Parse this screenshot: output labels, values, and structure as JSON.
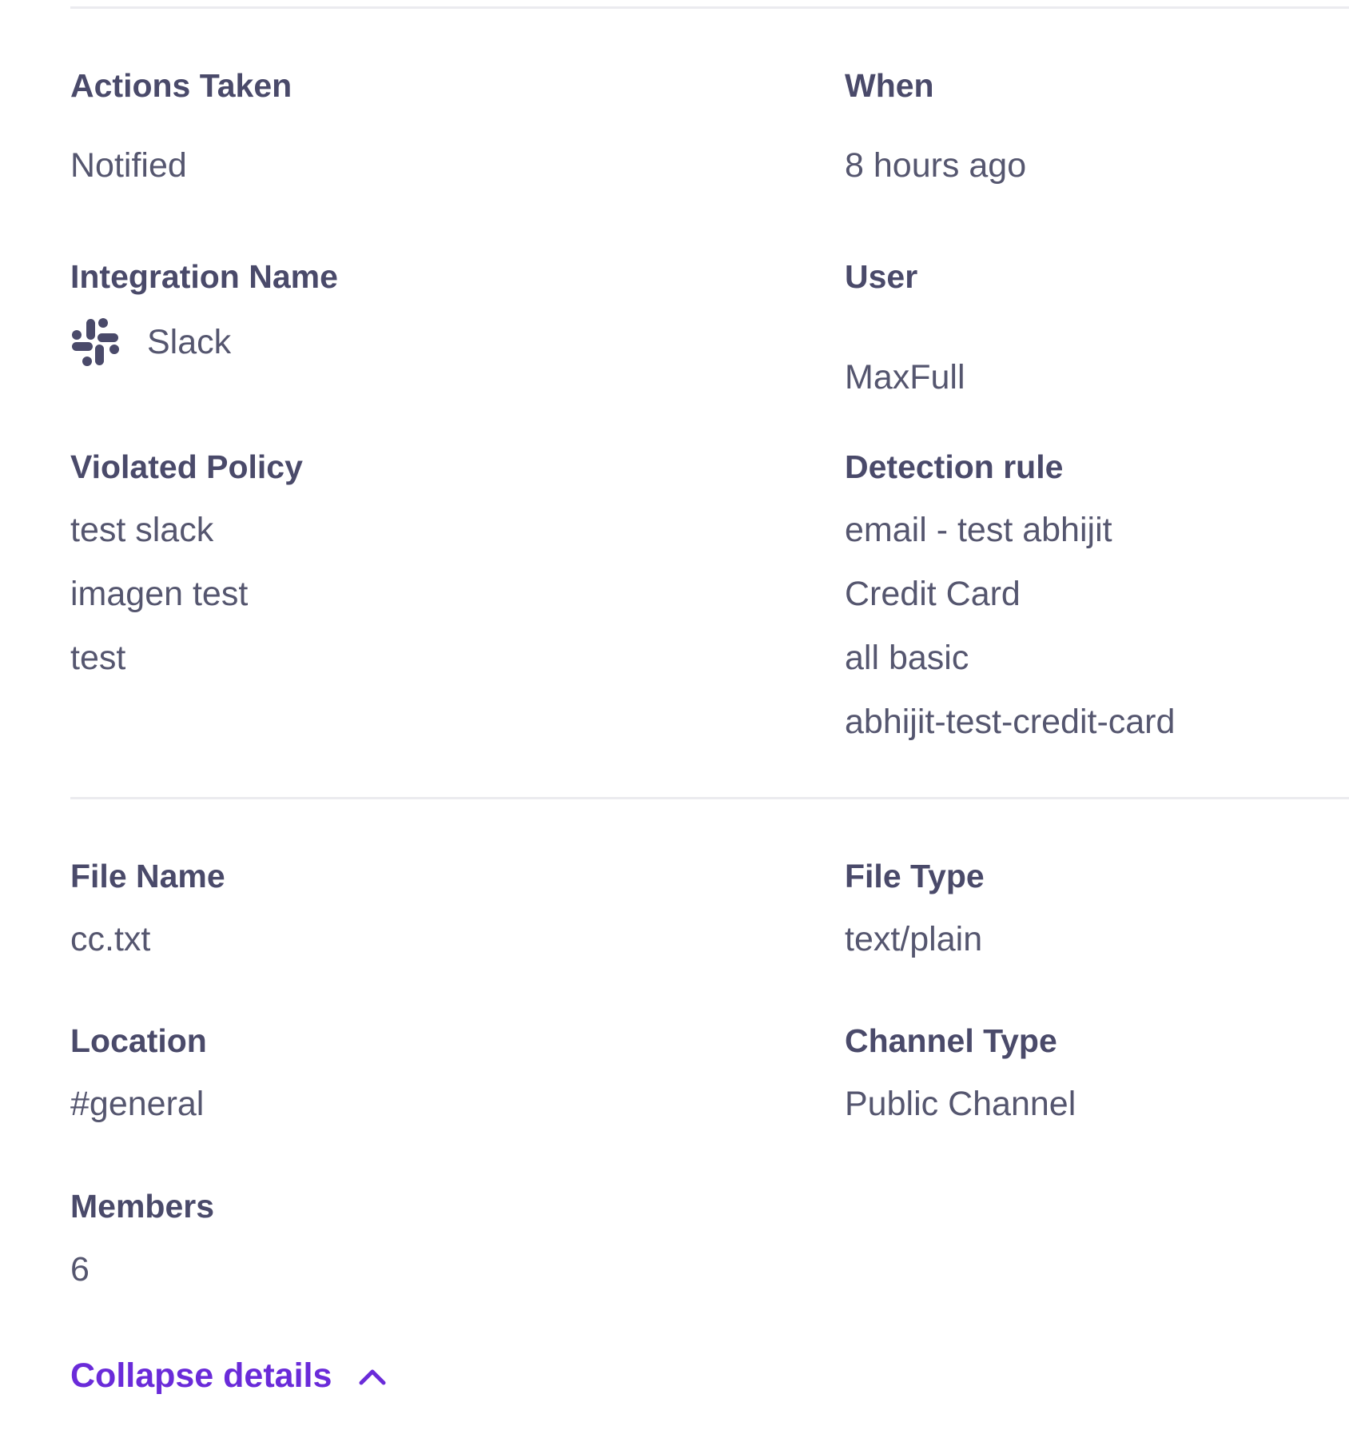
{
  "fields": {
    "actions_taken": {
      "label": "Actions Taken",
      "value": "Notified"
    },
    "when": {
      "label": "When",
      "value": "8 hours ago"
    },
    "integration_name": {
      "label": "Integration Name",
      "value": "Slack",
      "icon": "slack-icon"
    },
    "user": {
      "label": "User",
      "value": "MaxFull"
    },
    "violated_policy": {
      "label": "Violated Policy",
      "values": [
        "test slack",
        "imagen test",
        "test"
      ]
    },
    "detection_rule": {
      "label": "Detection rule",
      "values": [
        "email - test abhijit",
        "Credit Card",
        "all basic",
        "abhijit-test-credit-card"
      ]
    },
    "file_name": {
      "label": "File Name",
      "value": "cc.txt"
    },
    "file_type": {
      "label": "File Type",
      "value": "text/plain"
    },
    "location": {
      "label": "Location",
      "value": "#general"
    },
    "channel_type": {
      "label": "Channel Type",
      "value": "Public Channel"
    },
    "members": {
      "label": "Members",
      "value": "6"
    }
  },
  "collapse": {
    "label": "Collapse details",
    "icon": "chevron-up-icon"
  },
  "colors": {
    "label": "#4a4a6a",
    "value": "#55566f",
    "accent": "#6a2bd9",
    "divider": "#ebebef"
  }
}
